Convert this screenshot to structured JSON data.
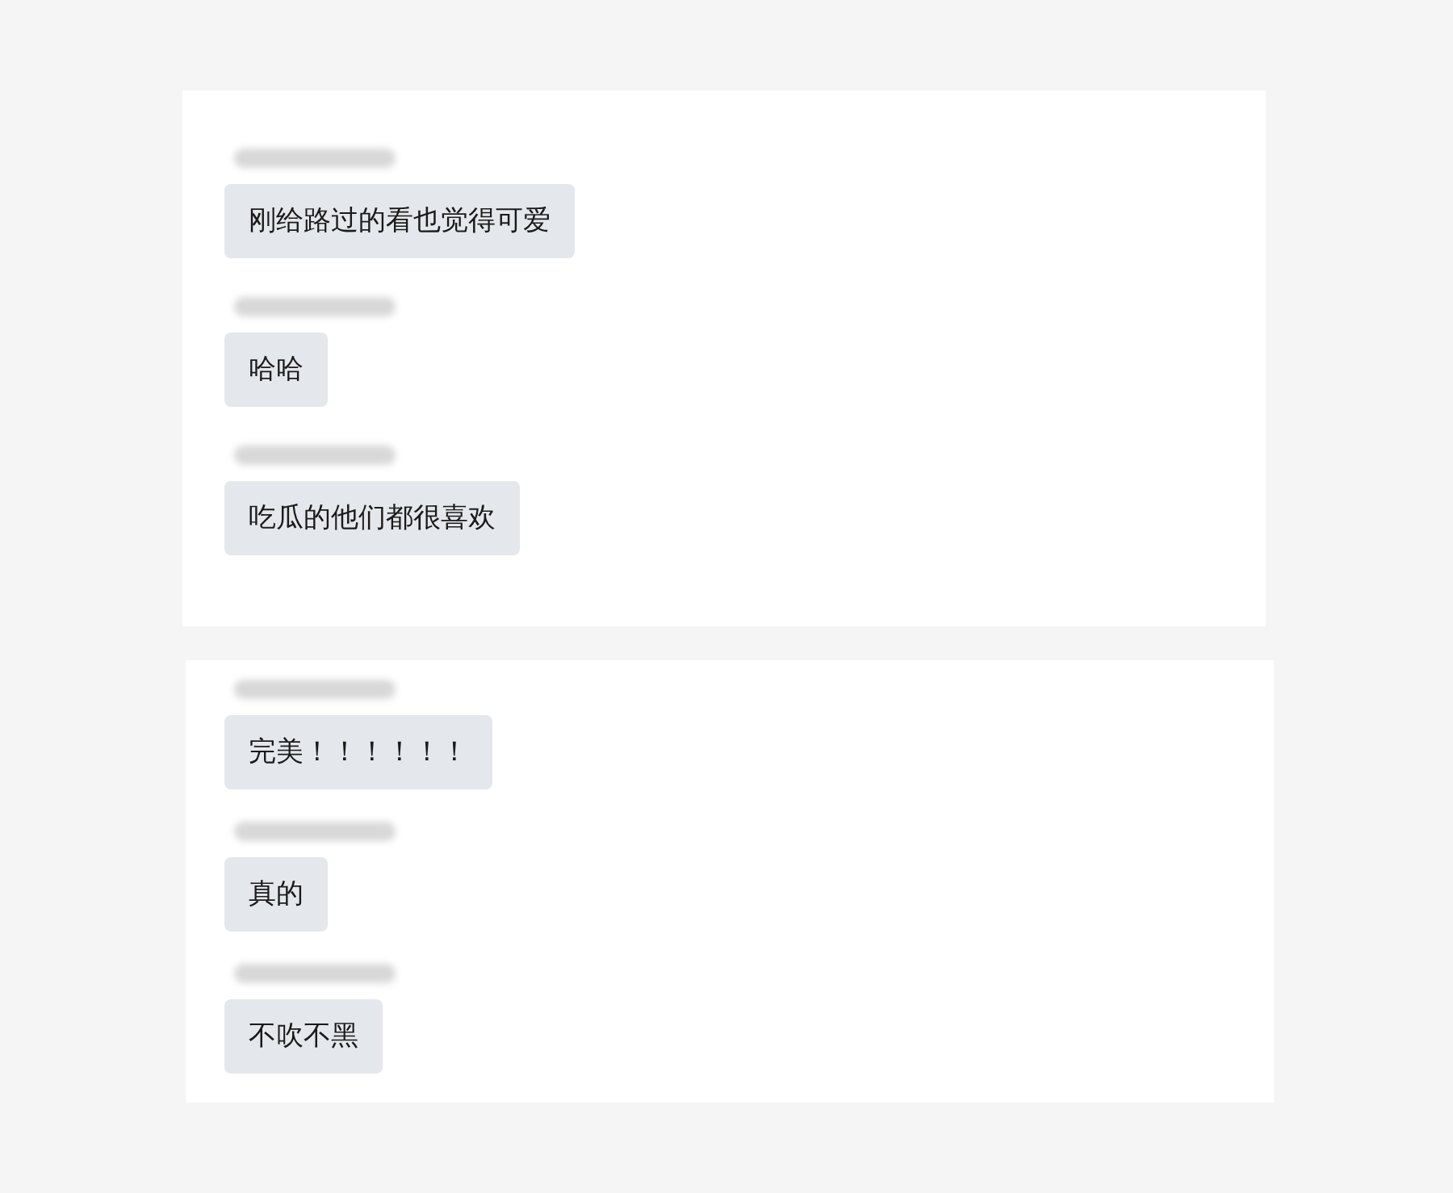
{
  "panels": [
    {
      "messages": [
        {
          "text": "刚给路过的看也觉得可爱"
        },
        {
          "text": "哈哈"
        },
        {
          "text": "吃瓜的他们都很喜欢"
        }
      ]
    },
    {
      "messages": [
        {
          "text": "完美！！！！！！"
        },
        {
          "text": "真的"
        },
        {
          "text": "不吹不黑"
        }
      ]
    }
  ]
}
